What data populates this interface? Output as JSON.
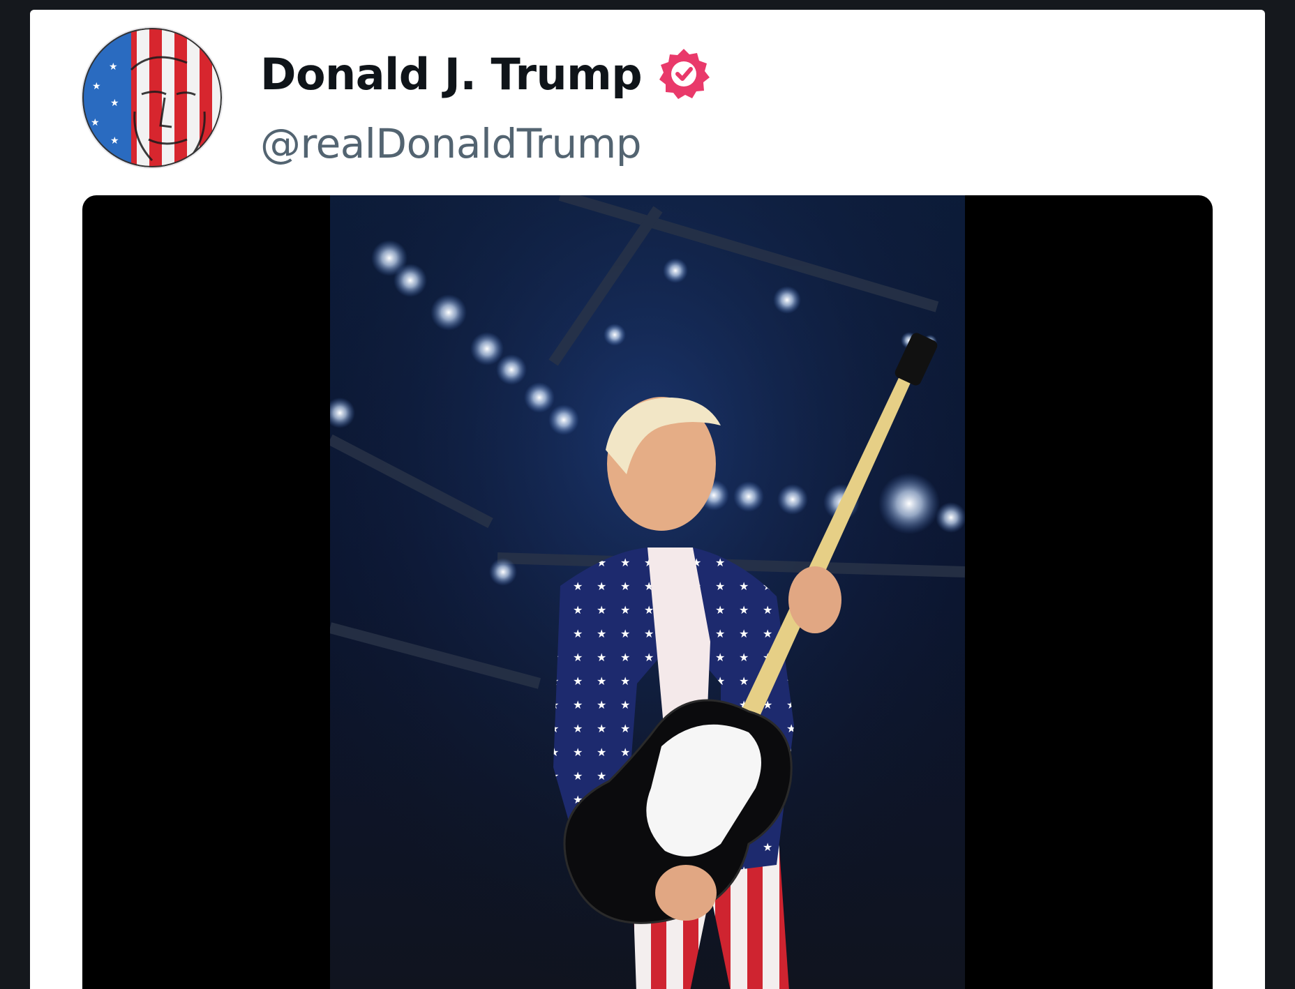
{
  "post": {
    "author": {
      "display_name": "Donald J. Trump",
      "handle": "@realDonaldTrump",
      "verified": true,
      "verified_badge_color": "#e9396a",
      "avatar_icon": "avatar-flag-portrait"
    },
    "media": {
      "type": "video",
      "icon": "video-still-guitar-stage"
    }
  },
  "colors": {
    "background": "#15181d",
    "card": "#ffffff",
    "name_text": "#0f1419",
    "handle_text": "#536471",
    "media_background": "#000000"
  }
}
